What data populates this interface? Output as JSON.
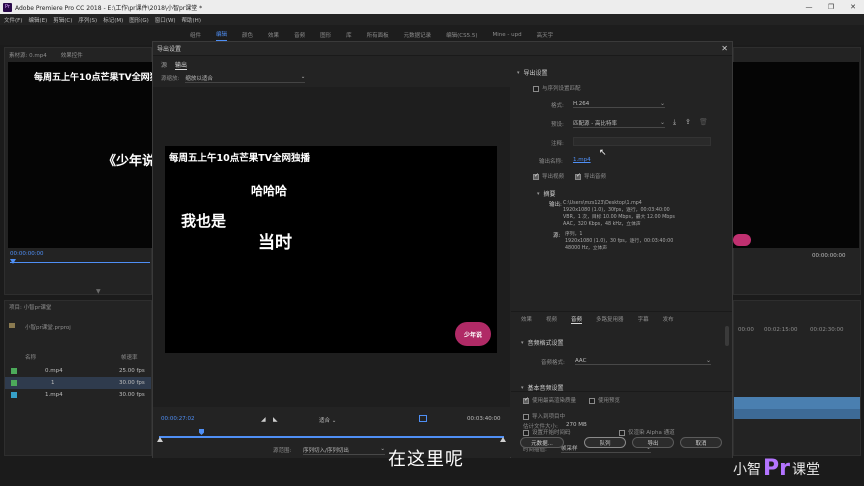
{
  "window": {
    "title": "Adobe Premiere Pro CC 2018 - E:\\工作\\pr课件\\2018\\小智pr课堂 *",
    "controls": [
      "—",
      "❐",
      "✕"
    ]
  },
  "menu": [
    "文件(F)",
    "编辑(E)",
    "剪辑(C)",
    "序列(S)",
    "标记(M)",
    "图形(G)",
    "窗口(W)",
    "帮助(H)"
  ],
  "workspaces": {
    "items": [
      "组件",
      "编辑",
      "颜色",
      "效果",
      "音频",
      "图形",
      "库",
      "所有面板",
      "元数据记录",
      "编辑(CS5.5)",
      "Mine - upd",
      "高天宇"
    ],
    "active_index": 1
  },
  "source_monitor": {
    "tab": "素材源: 0.mp4",
    "tab2": "效果控件",
    "title_fragment": "《少年说",
    "timecode": "00:00:00:00",
    "timecode2": "00:00:00:00"
  },
  "project": {
    "tab": "项目: 小智pr课堂",
    "file": "小智pr课堂.prproj",
    "col_name": "名称",
    "col_rate": "帧速率",
    "items": [
      {
        "name": "0.mp4",
        "rate": "25.00 fps",
        "color": "#4caa5a"
      },
      {
        "name": "1",
        "rate": "30.00 fps",
        "color": "#4caa5a"
      },
      {
        "name": "1.mp4",
        "rate": "30.00 fps",
        "color": "#36a0c8"
      }
    ]
  },
  "program_timeline": {
    "ruler": [
      "00:00",
      "00:02:15:00",
      "00:02:30:00"
    ]
  },
  "dialog": {
    "title": "导出设置",
    "close": "✕",
    "tabs": [
      "源",
      "输出"
    ],
    "active_tab": 1,
    "source_scale_label": "源缩放:",
    "source_scale_value": "缩放以适合",
    "preview": {
      "banner": "每周五上午10点芒果TV全网独播",
      "text_a": "哈哈哈",
      "text_b": "我也是",
      "text_c": "当时",
      "logo": "少年说"
    },
    "playbar": {
      "timecode_in": "00:00:27:02",
      "fit_label": "适合",
      "timecode_out": "00:03:40:00",
      "range_label": "源范围:",
      "range_value": "序列切入/序列切出"
    },
    "export_settings": {
      "heading": "导出设置",
      "match_sequence_label": "与序列设置匹配",
      "format_label": "格式:",
      "format_value": "H.264",
      "preset_label": "预设:",
      "preset_value": "匹配源 - 高比特率",
      "comment_label": "注释:",
      "output_name_label": "输出名称:",
      "output_name_value": "1.mp4",
      "export_video_label": "导出视频",
      "export_audio_label": "导出音频"
    },
    "summary": {
      "heading": "摘要",
      "output_label": "输出:",
      "output_lines": [
        "C:\\Users\\mzs123\\Desktop\\1.mp4",
        "1920x1080 (1.0)，30fps，逐行，00:03:40:00",
        "VBR，1 次，目标 10.00 Mbps，最大 12.00 Mbps",
        "AAC，320 Kbps，48 kHz，立体声"
      ],
      "source_label": "源:",
      "source_lines": [
        "序列，1",
        "1920x1080 (1.0)，30 fps，逐行，00:03:40:00",
        "48000 Hz，立体声"
      ]
    },
    "settings_tabs": [
      "效果",
      "视频",
      "音频",
      "多路复用器",
      "字幕",
      "发布"
    ],
    "active_settings_tab": 2,
    "audio_format_heading": "音频格式设置",
    "audio_format_label": "音频格式:",
    "audio_format_value": "AAC",
    "basic_audio_heading": "基本音频设置",
    "options": {
      "max_render_quality": "使用最高渲染质量",
      "use_previews": "使用预览",
      "import_into_project": "导入到项目中",
      "set_start_timecode": "设置开始时间码",
      "render_alpha_only": "仅渲染 Alpha 通道",
      "time_interp_label": "时间插值:",
      "time_interp_value": "帧采样",
      "file_size_label": "估计文件大小:",
      "file_size_value": "270 MB"
    },
    "buttons": {
      "metadata": "元数据...",
      "queue": "队列",
      "export": "导出",
      "cancel": "取消"
    }
  },
  "caption": "在这里呢",
  "watermark": {
    "pre": "小智",
    "pr": "Pr",
    "post": "课堂"
  }
}
